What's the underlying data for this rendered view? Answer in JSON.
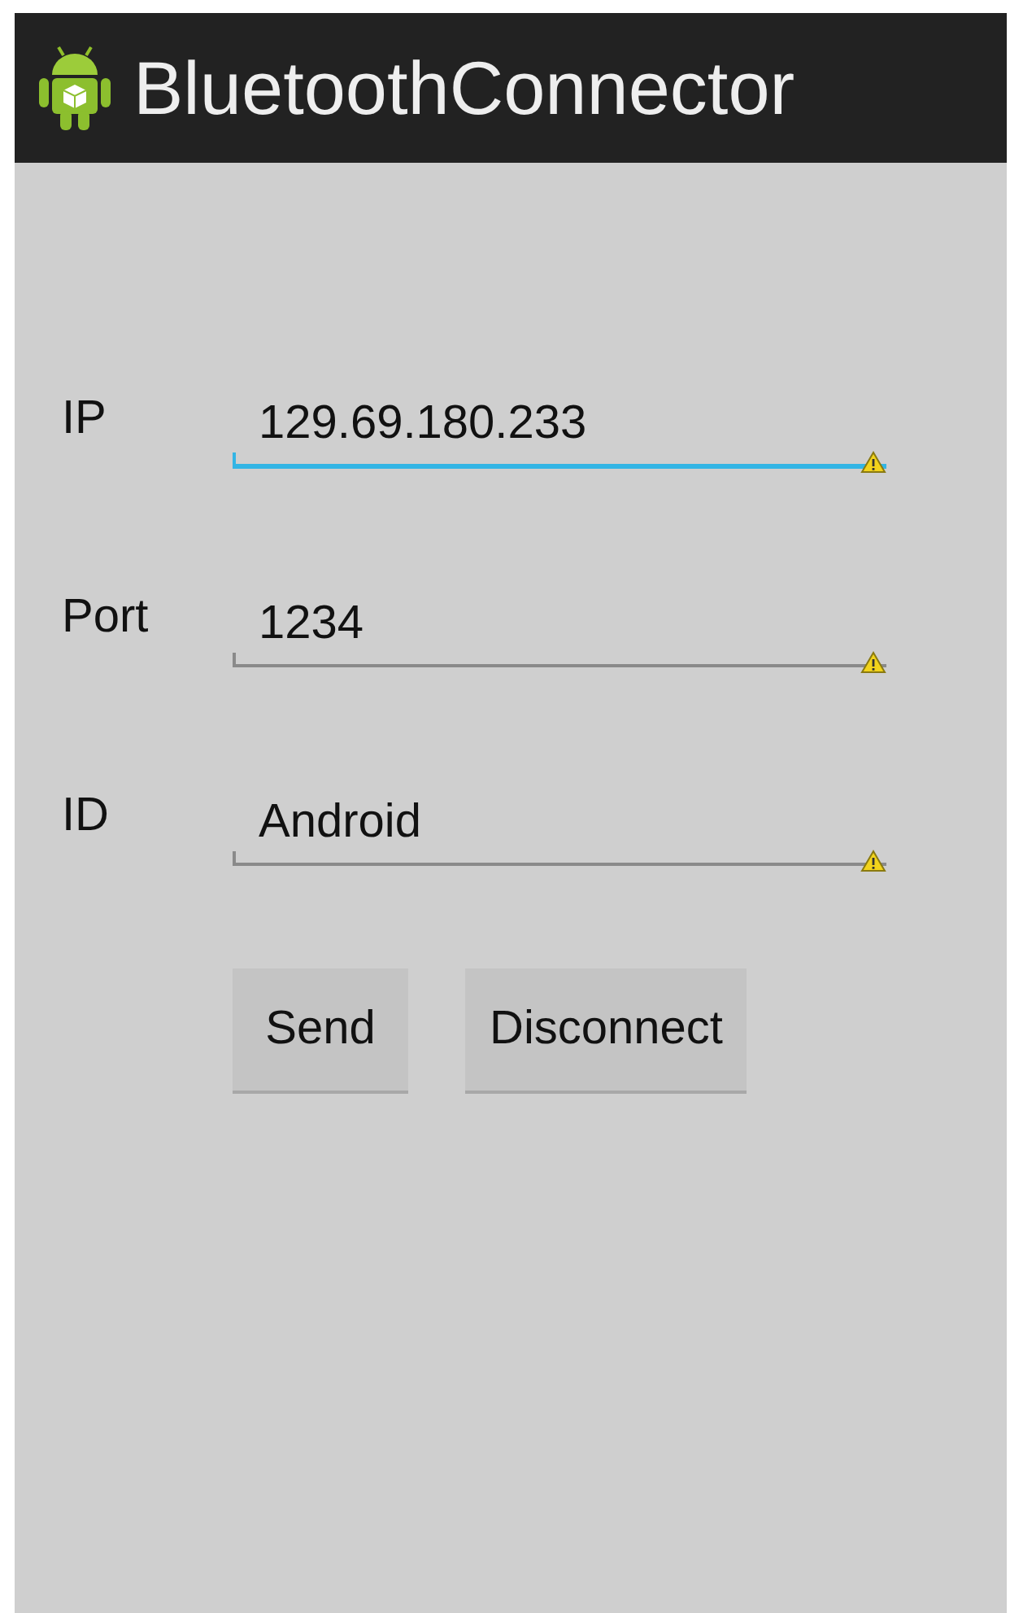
{
  "action_bar": {
    "title": "BluetoothConnector"
  },
  "fields": [
    {
      "label": "IP",
      "value": "129.69.180.233",
      "focused": true,
      "warning": true
    },
    {
      "label": "Port",
      "value": "1234",
      "focused": false,
      "warning": true
    },
    {
      "label": "ID",
      "value": "Android",
      "focused": false,
      "warning": true
    }
  ],
  "buttons": [
    {
      "label": "Send"
    },
    {
      "label": "Disconnect"
    }
  ]
}
